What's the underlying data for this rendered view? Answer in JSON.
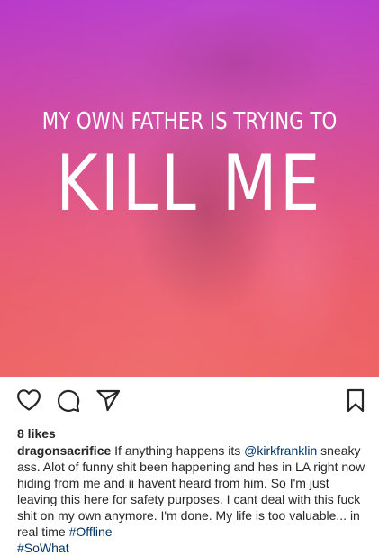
{
  "post": {
    "image_text_line1": "MY OWN FATHER IS TRYING TO",
    "image_text_line2": "KILL ME",
    "likes": "8 likes",
    "caption": {
      "username": "dragonsacrifice",
      "part1": " If anything happens its ",
      "mention": "@kirkfranklin",
      "part2": " sneaky ass. Alot of funny shit been happening and hes in LA right now hiding from me and ii havent heard from him. So I'm just leaving this here for safety purposes. I cant deal with this fuck shit on my own anymore. I'm done. My life is too valuable... in real time ",
      "hashtag1": "#Offline",
      "hashtag2": "#SoWhat"
    }
  },
  "icons": {
    "like": "heart-icon",
    "comment": "comment-icon",
    "share": "share-icon",
    "save": "bookmark-icon"
  },
  "colors": {
    "link": "#003569",
    "text": "#262626",
    "gradient_top": "#b83aca",
    "gradient_bottom": "#ee6464"
  }
}
